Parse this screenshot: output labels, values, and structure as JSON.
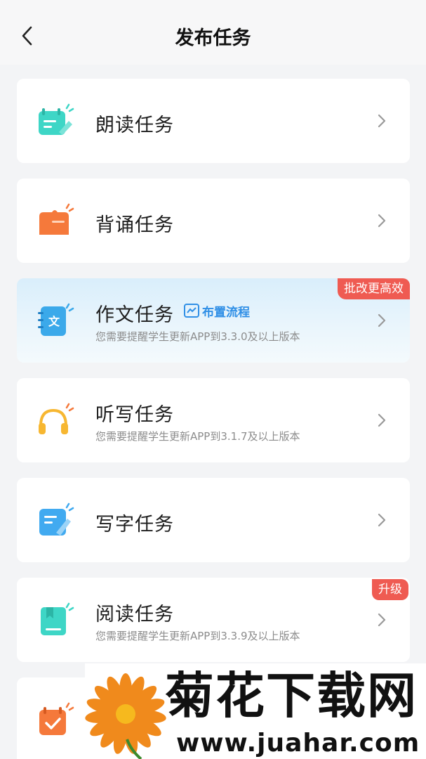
{
  "header": {
    "title": "发布任务"
  },
  "tasks": [
    {
      "title": "朗读任务",
      "subtitle": "",
      "badge": "",
      "icon": "read-aloud-icon",
      "color": "#3ed6c6"
    },
    {
      "title": "背诵任务",
      "subtitle": "",
      "badge": "",
      "icon": "recite-icon",
      "color": "#f5793b"
    },
    {
      "title": "作文任务",
      "subtitle": "您需要提醒学生更新APP到3.3.0及以上版本",
      "badge": "批改更高效",
      "icon": "essay-icon",
      "color": "#3ba9ea",
      "link": "布置流程"
    },
    {
      "title": "听写任务",
      "subtitle": "您需要提醒学生更新APP到3.1.7及以上版本",
      "badge": "",
      "icon": "headphones-icon",
      "color": "#f7b731"
    },
    {
      "title": "写字任务",
      "subtitle": "",
      "badge": "",
      "icon": "writing-icon",
      "color": "#41aaf0"
    },
    {
      "title": "阅读任务",
      "subtitle": "您需要提醒学生更新APP到3.3.9及以上版本",
      "badge": "升级",
      "icon": "book-icon",
      "color": "#3ed6c6"
    },
    {
      "title": "",
      "subtitle": "",
      "badge": "",
      "icon": "calendar-check-icon",
      "color": "#f5793b"
    }
  ],
  "watermark": {
    "name": "菊花下载网",
    "url": "www.juahar.com"
  }
}
